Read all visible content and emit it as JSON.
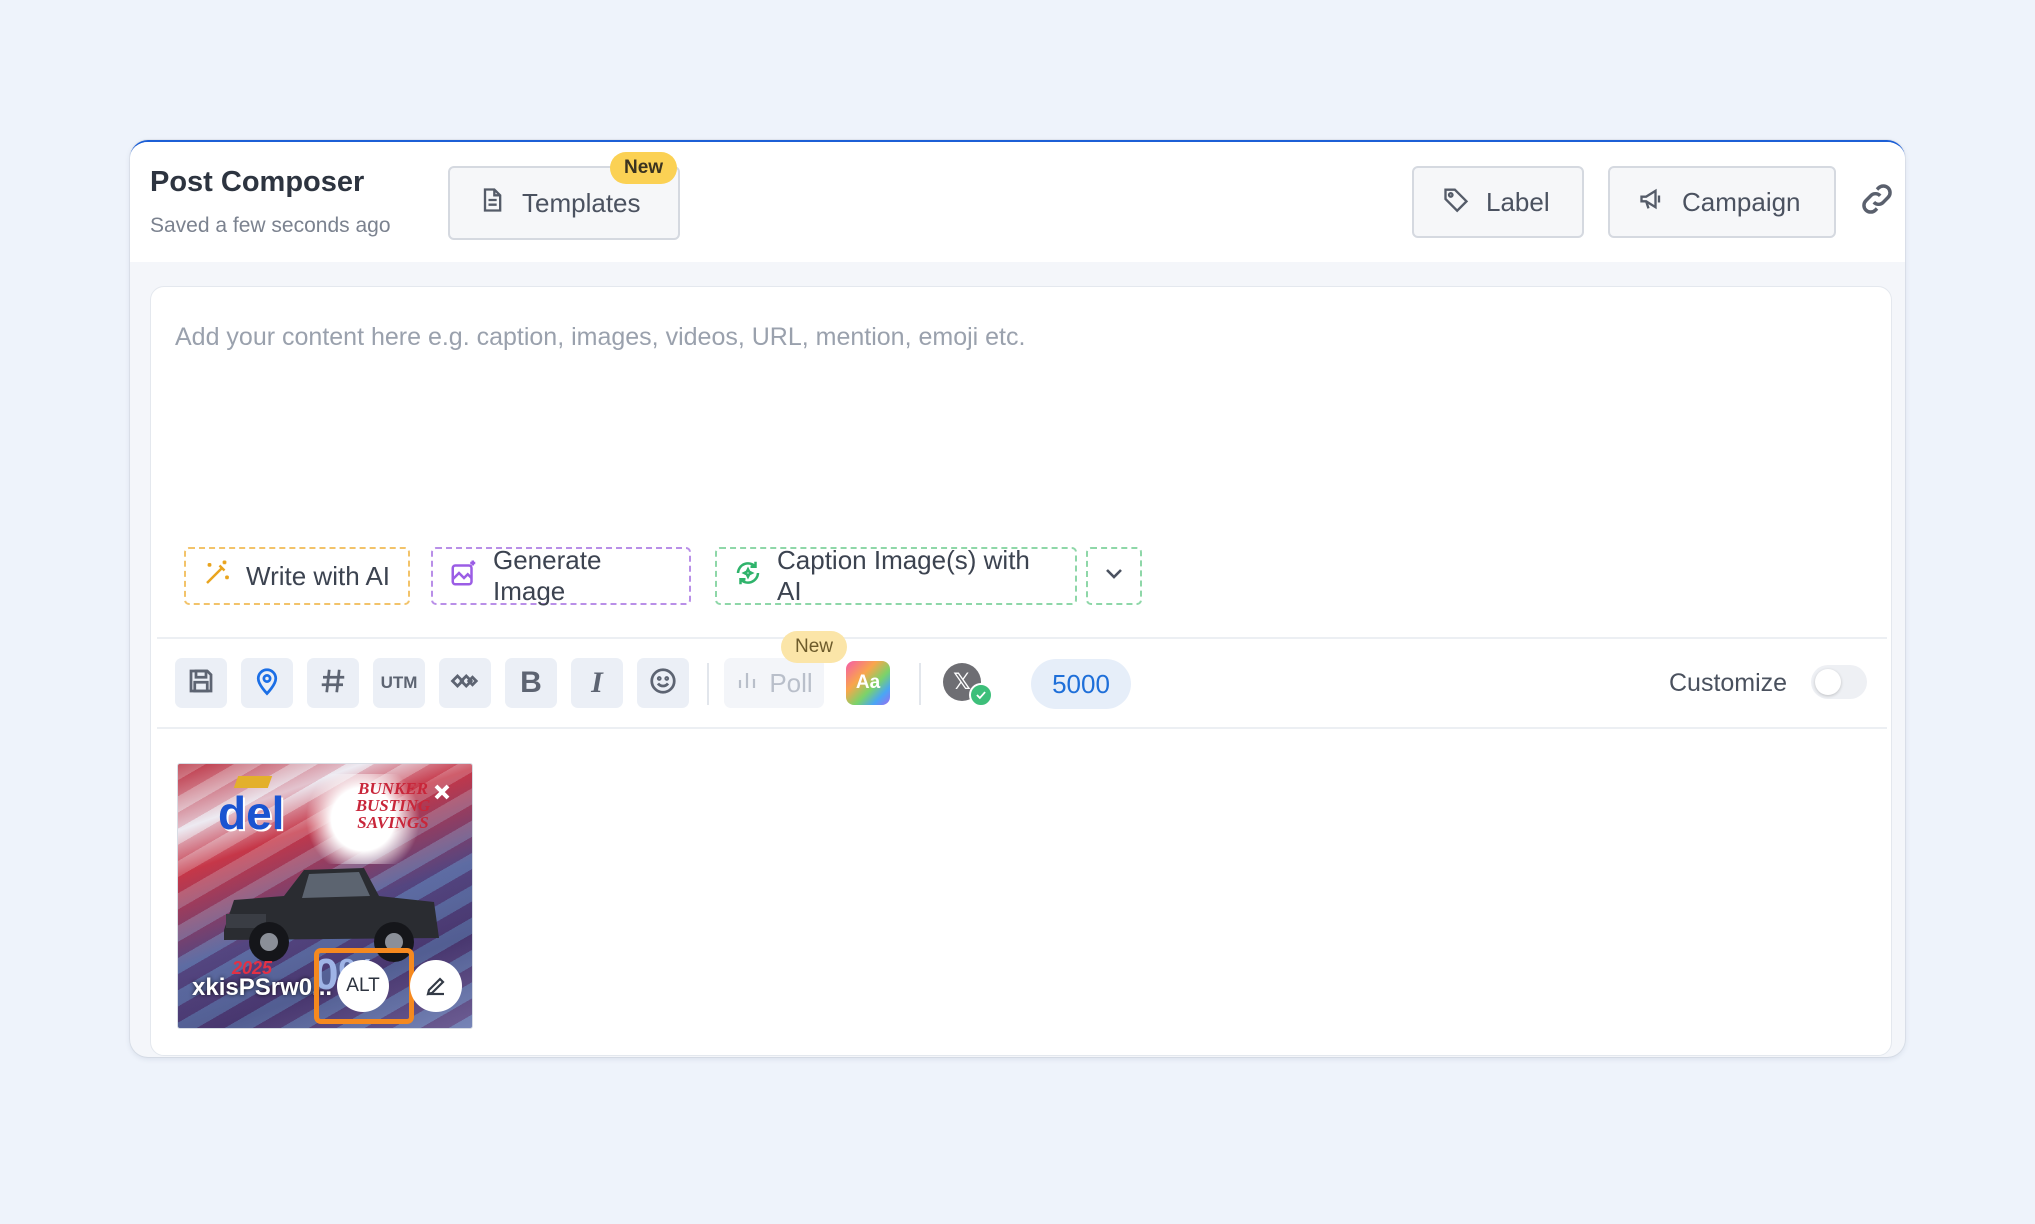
{
  "header": {
    "title": "Post Composer",
    "subtitle": "Saved a few seconds ago",
    "templates_label": "Templates",
    "templates_badge": "New",
    "label_button": "Label",
    "campaign_button": "Campaign"
  },
  "editor": {
    "placeholder": "Add your content here e.g. caption, images, videos, URL, mention, emoji etc.",
    "ai_actions": {
      "write": "Write with AI",
      "generate": "Generate Image",
      "caption": "Caption Image(s) with AI"
    }
  },
  "toolbar": {
    "utm_label": "UTM",
    "bold_label": "B",
    "italic_label": "I",
    "poll_label": "Poll",
    "poll_badge": "New",
    "aa_label": "Aa",
    "account_icon": "x-logo-icon",
    "char_count": "5000",
    "customize_label": "Customize",
    "customize_on": false
  },
  "media": {
    "filename": "xkisPSrw0...",
    "alt_label": "ALT",
    "logo_text": "del",
    "promo_text": "BUNKER BUSTING SAVINGS",
    "year_text": "2025",
    "percent_text": "0%"
  },
  "colors": {
    "accent": "#1c6fe6",
    "highlight": "#f5891f",
    "badge": "#fbd154"
  }
}
